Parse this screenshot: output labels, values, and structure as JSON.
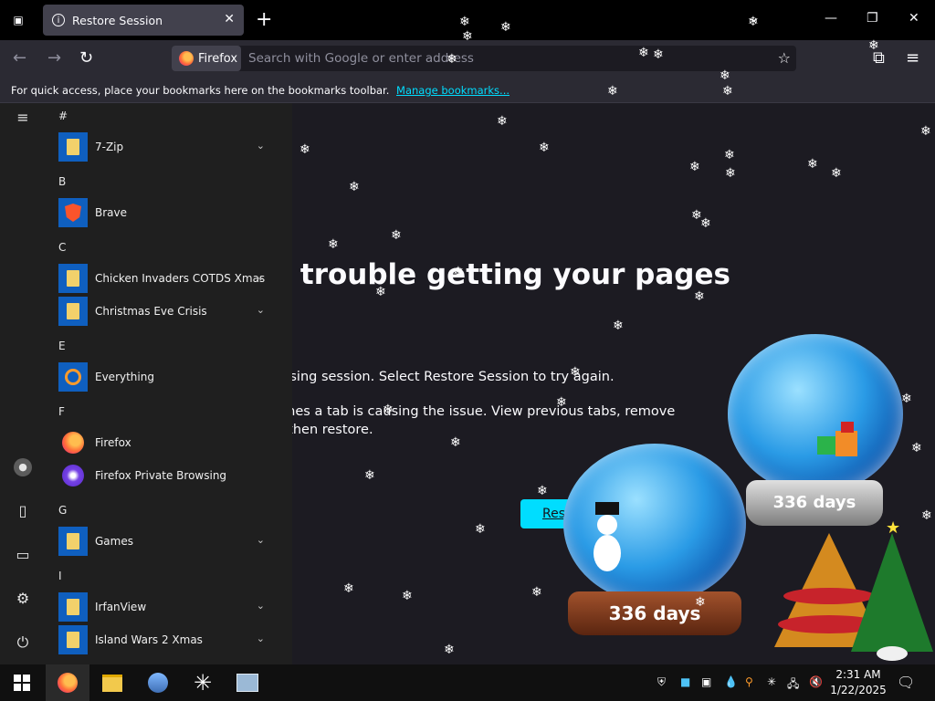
{
  "browser": {
    "tab_title": "Restore Session",
    "identity_label": "Firefox",
    "url_placeholder": "Search with Google or enter address",
    "bookmarks_message": "For quick access, place your bookmarks here on the bookmarks toolbar.",
    "bookmarks_link": "Manage bookmarks..."
  },
  "page": {
    "heading": "having trouble getting your pages",
    "paragraph1": "g your last browsing session. Select Restore Session to try again.",
    "paragraph2": "ession? Sometimes a tab is causing the issue. View previous tabs, remove\nto recover, and then restore.",
    "restore_button": "Res"
  },
  "start_menu": {
    "groups": [
      {
        "letter": "#",
        "apps": [
          {
            "name": "7-Zip",
            "icon": "folder-icon",
            "expandable": true
          }
        ]
      },
      {
        "letter": "B",
        "apps": [
          {
            "name": "Brave",
            "icon": "brave-icon",
            "expandable": false
          }
        ]
      },
      {
        "letter": "C",
        "apps": [
          {
            "name": "Chicken Invaders COTDS Xmas",
            "icon": "folder-icon",
            "expandable": true
          },
          {
            "name": "Christmas Eve Crisis",
            "icon": "folder-icon",
            "expandable": true
          }
        ]
      },
      {
        "letter": "E",
        "apps": [
          {
            "name": "Everything",
            "icon": "search-icon",
            "expandable": false
          }
        ]
      },
      {
        "letter": "F",
        "apps": [
          {
            "name": "Firefox",
            "icon": "firefox-icon",
            "expandable": false
          },
          {
            "name": "Firefox Private Browsing",
            "icon": "private-browsing-icon",
            "expandable": false
          }
        ]
      },
      {
        "letter": "G",
        "apps": [
          {
            "name": "Games",
            "icon": "folder-icon",
            "expandable": true
          }
        ]
      },
      {
        "letter": "I",
        "apps": [
          {
            "name": "IrfanView",
            "icon": "folder-icon",
            "expandable": true
          },
          {
            "name": "Island Wars 2 Xmas",
            "icon": "folder-icon",
            "expandable": true
          }
        ]
      }
    ]
  },
  "globes": {
    "left_label": "336 days",
    "right_label": "336 days"
  },
  "taskbar": {
    "time": "2:31 AM",
    "date": "1/22/2025"
  },
  "colors": {
    "accent": "#00ddff",
    "tile_blue": "#0f5fbf",
    "page_bg": "#1c1b22"
  }
}
